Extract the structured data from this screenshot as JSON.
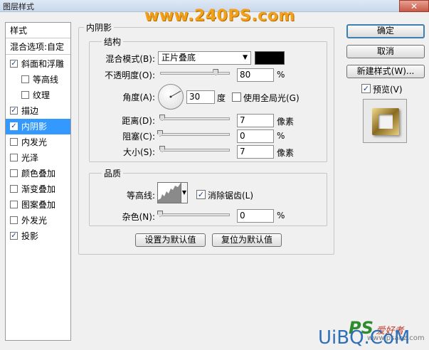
{
  "window": {
    "title": "图层样式",
    "close_label": "✕"
  },
  "watermark_top": "www.240PS.com",
  "sidebar": {
    "header": "样式",
    "blend_options": "混合选项:自定",
    "items": [
      {
        "label": "斜面和浮雕",
        "checked": "✓"
      },
      {
        "label": "等高线",
        "checked": ""
      },
      {
        "label": "纹理",
        "checked": ""
      },
      {
        "label": "描边",
        "checked": "✓"
      },
      {
        "label": "内阴影",
        "checked": "✓"
      },
      {
        "label": "内发光",
        "checked": ""
      },
      {
        "label": "光泽",
        "checked": ""
      },
      {
        "label": "颜色叠加",
        "checked": ""
      },
      {
        "label": "渐变叠加",
        "checked": ""
      },
      {
        "label": "图案叠加",
        "checked": ""
      },
      {
        "label": "外发光",
        "checked": ""
      },
      {
        "label": "投影",
        "checked": "✓"
      }
    ]
  },
  "panel": {
    "title": "内阴影",
    "structure": {
      "title": "结构",
      "blend_mode_label": "混合模式(B):",
      "blend_mode_value": "正片叠底",
      "opacity_label": "不透明度(O):",
      "opacity_value": "80",
      "opacity_unit": "%",
      "opacity_fraction": 0.8,
      "angle_label": "角度(A):",
      "angle_value": "30",
      "angle_unit": "度",
      "global_light_label": "使用全局光(G)",
      "distance_label": "距离(D):",
      "distance_value": "7",
      "distance_unit": "像素",
      "distance_fraction": 0.03,
      "choke_label": "阻塞(C):",
      "choke_value": "0",
      "choke_unit": "%",
      "choke_fraction": 0,
      "size_label": "大小(S):",
      "size_value": "7",
      "size_unit": "像素",
      "size_fraction": 0.03
    },
    "quality": {
      "title": "品质",
      "contour_label": "等高线:",
      "antialias_label": "消除锯齿(L)",
      "antialias_checked": "✓",
      "noise_label": "杂色(N):",
      "noise_value": "0",
      "noise_unit": "%",
      "noise_fraction": 0
    },
    "set_default": "设置为默认值",
    "reset_default": "复位为默认值"
  },
  "buttons": {
    "ok": "确定",
    "cancel": "取消",
    "new_style": "新建样式(W)...",
    "preview_label": "预览(V)",
    "preview_checked": "✓"
  },
  "logo": {
    "ps": "PS",
    "zh": "爱好者",
    "url": "www.psahz.com",
    "uibq": "UiBQ.CoM"
  }
}
